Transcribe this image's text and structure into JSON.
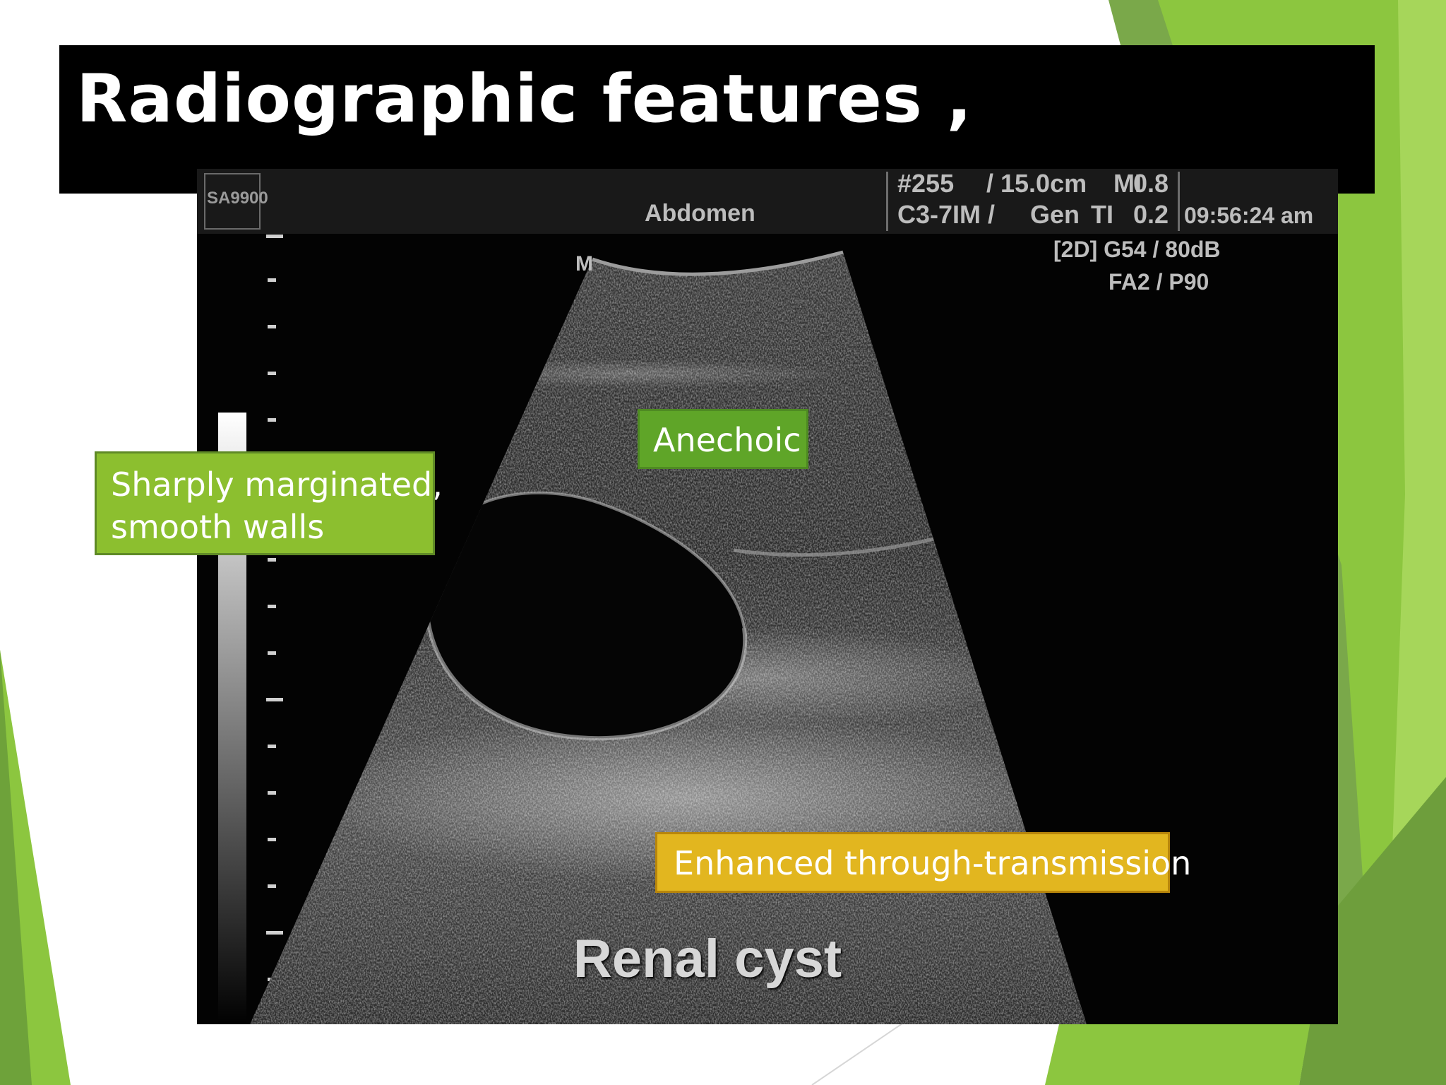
{
  "slide": {
    "title": "Radiographic features ,"
  },
  "ultrasound": {
    "logo": "SA9900",
    "preset": "Abdomen",
    "frame": "#255",
    "depth": "/ 15.0cm",
    "mi_label": "MI",
    "mi_value": "0.8",
    "probe": "C3-7IM /",
    "gen": "Gen",
    "ti_label": "TI",
    "ti_value": "0.2",
    "time": "09:56:24 am",
    "mode_gain": "[2D] G54 / 80dB",
    "fa_power": "FA2 / P90",
    "marker": "M",
    "caption": "Renal cyst"
  },
  "labels": {
    "walls_line1": "Sharply marginated,",
    "walls_line2": "smooth walls",
    "anechoic": "Anechoic",
    "transmission": "Enhanced through-transmission"
  },
  "colors": {
    "green_label": "#8cbf2f",
    "green_border": "#5f8a26",
    "yellow_label": "#e2b61f",
    "yellow_border": "#b8860b",
    "accent_green": "#8cc63f"
  }
}
